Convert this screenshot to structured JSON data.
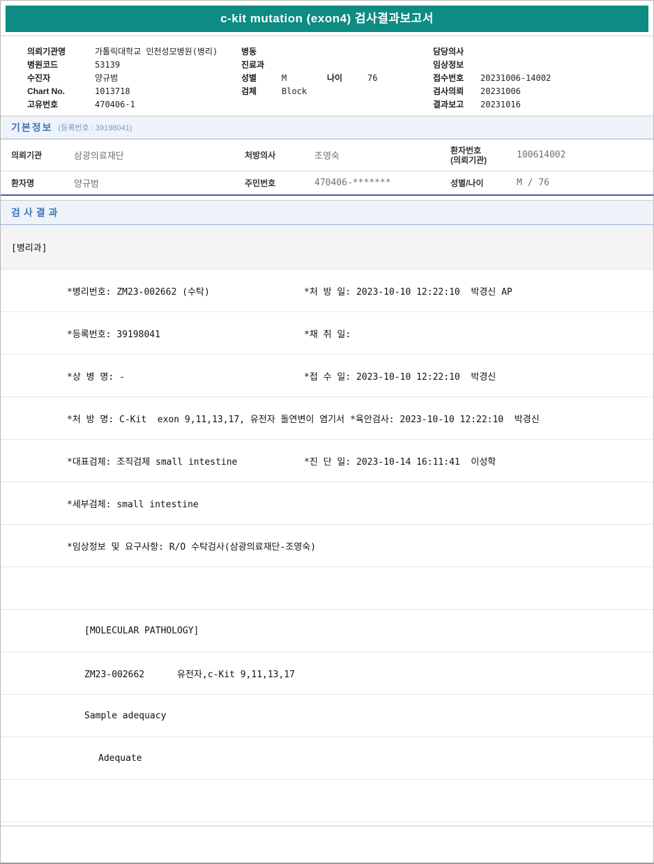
{
  "colors": {
    "banner": "#0e8b82",
    "section_bg": "#eef3f9",
    "section_title": "#3c79b8",
    "navy_border": "#3d5c9e"
  },
  "header": {
    "title": "c-kit mutation (exon4) 검사결과보고서"
  },
  "top_info": {
    "left": [
      {
        "label": "의뢰기관명",
        "value": "가톨릭대학교 인천성모병원(병리)"
      },
      {
        "label": "병원코드",
        "value": "53139"
      },
      {
        "label": "수진자",
        "value": "양규범"
      },
      {
        "label": "Chart No.",
        "value": "1013718"
      },
      {
        "label": "고유번호",
        "value": "470406-1"
      }
    ],
    "middle": {
      "ward_label": "병동",
      "dept_label": "진료과",
      "sex_label": "성별",
      "sex_value": "M",
      "age_label": "나이",
      "age_value": "76",
      "specimen_label": "검체",
      "specimen_value": "Block"
    },
    "right": [
      {
        "label": "담당의사",
        "value": ""
      },
      {
        "label": "임상정보",
        "value": ""
      },
      {
        "label": "접수번호",
        "value": "20231006-14002"
      },
      {
        "label": "검사의뢰",
        "value": "20231006"
      },
      {
        "label": "결과보고",
        "value": "20231016"
      }
    ]
  },
  "basic_info": {
    "title": "기본정보",
    "reg_note": "(등록번호 : 39198041)",
    "row1": {
      "c1_label": "의뢰기관",
      "c1_value": "삼광의료재단",
      "c2_label": "처방의사",
      "c2_value": "조영숙",
      "c3_label_line1": "환자번호",
      "c3_label_line2": "(의뢰기관)",
      "c3_value": "100614002"
    },
    "row2": {
      "c1_label": "환자명",
      "c1_value": "양규범",
      "c2_label": "주민번호",
      "c2_value": "470406-*******",
      "c3_label": "성별/나이",
      "c3_value": "M / 76"
    }
  },
  "results": {
    "title": "검사결과",
    "department": "[병리과]",
    "rows": [
      {
        "left": "*병리번호: ZM23-002662 (수탁)",
        "right": "*처 방 일: 2023-10-10 12:22:10  박경신 AP"
      },
      {
        "left": "*등록번호: 39198041",
        "right": "*채 취 일:"
      },
      {
        "left": "*상 병 명: -",
        "right": "*접 수 일: 2023-10-10 12:22:10  박경신"
      },
      {
        "left": "*처 방 명: C-Kit  exon 9,11,13,17, 유전자 돌연변이 염기서",
        "right": "*육안검사: 2023-10-10 12:22:10  박경신"
      },
      {
        "left": "*대표검체: 조직검체 small intestine",
        "right": "*진 단 일: 2023-10-14 16:11:41  이성학"
      },
      {
        "left": "*세부검체: small intestine",
        "right": ""
      },
      {
        "left": "*임상정보 및 요구사항: R/O 수탁검사(삼광의료재단-조영숙)",
        "right": ""
      },
      {
        "left": "",
        "right": ""
      },
      {
        "left": "[MOLECULAR PATHOLOGY]",
        "right": ""
      },
      {
        "left": "ZM23-002662      유전자,c-Kit 9,11,13,17",
        "right": ""
      },
      {
        "left": "Sample adequacy",
        "right": ""
      },
      {
        "left": "Adequate",
        "right": ""
      },
      {
        "left": "",
        "right": ""
      }
    ]
  }
}
